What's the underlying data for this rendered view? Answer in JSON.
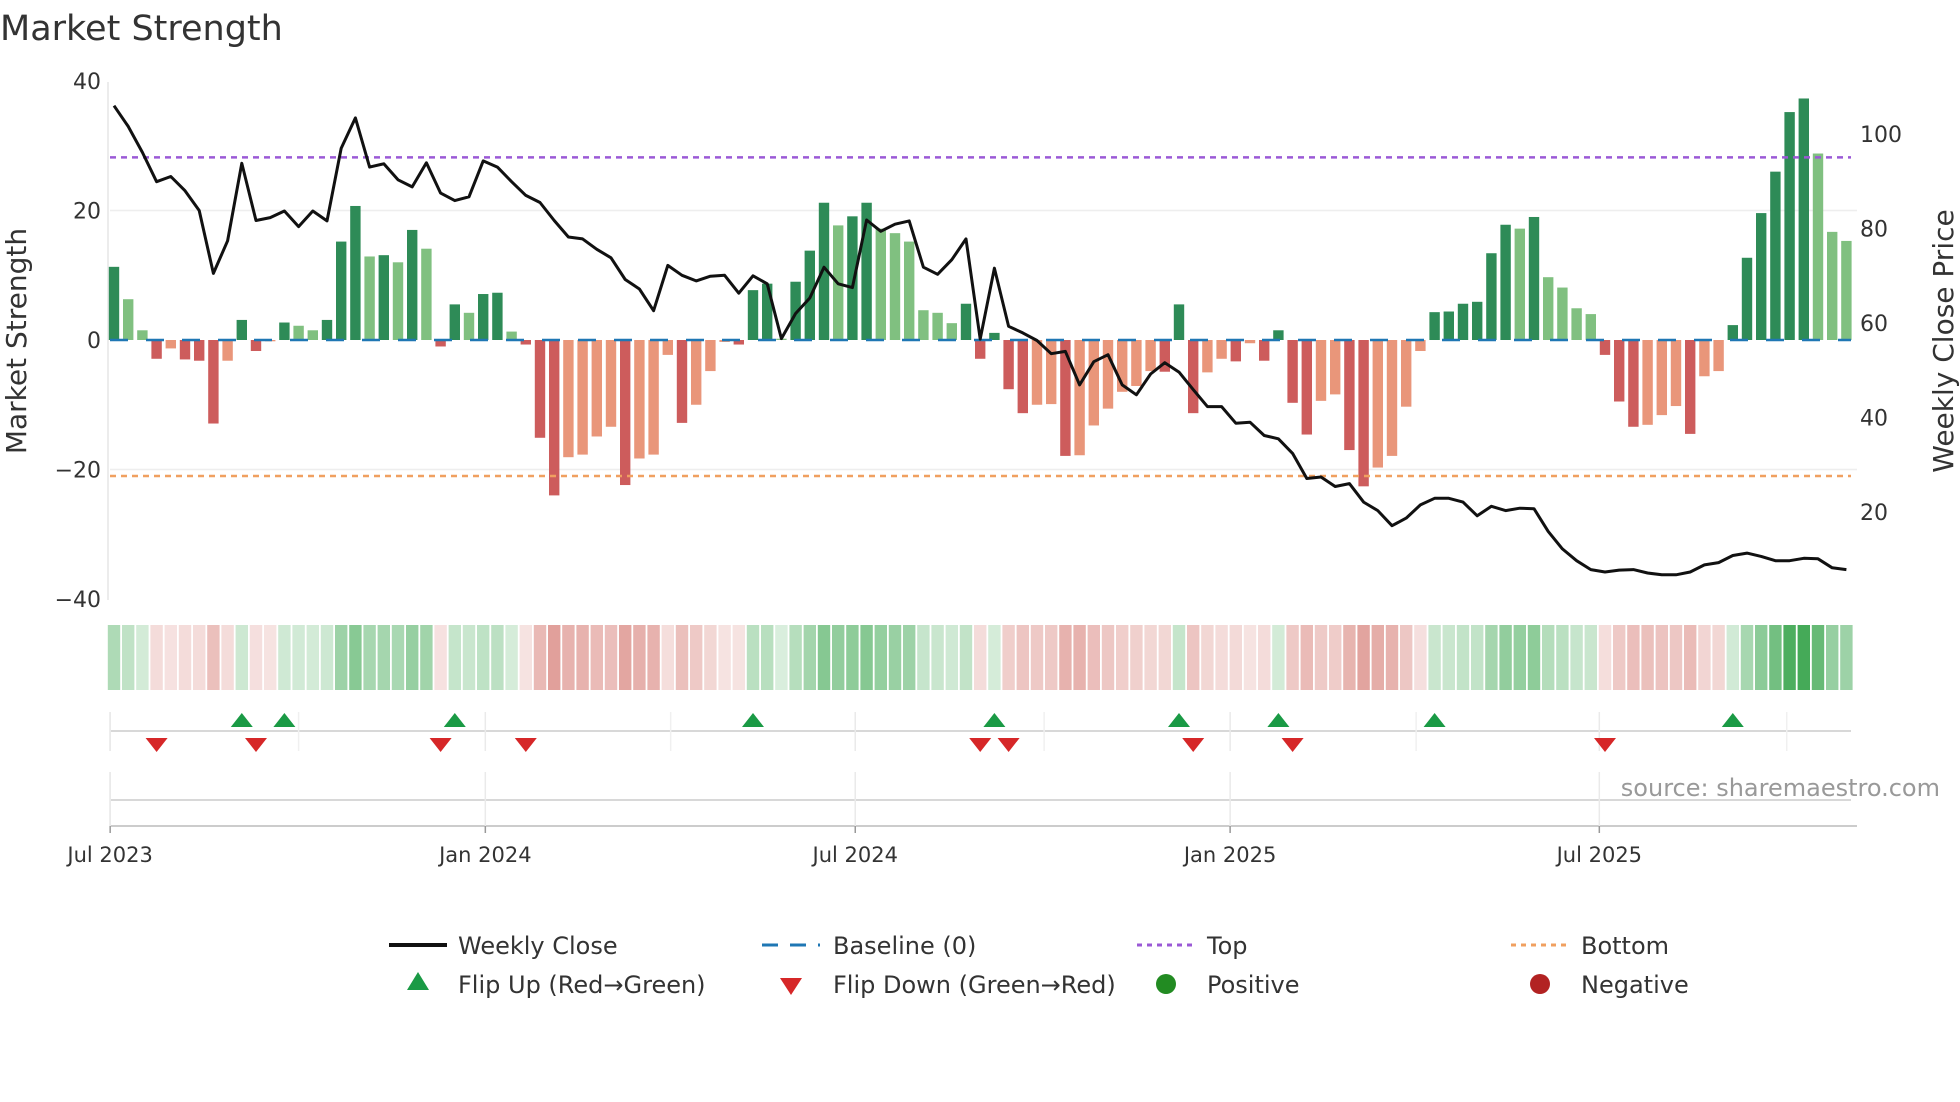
{
  "chart_data": {
    "type": "bar",
    "title": "Market Strength",
    "ylabel": "Market Strength",
    "y2label": "Weekly Close Price",
    "ylim": [
      -40,
      40
    ],
    "y2lim": [
      1.4,
      111
    ],
    "y_ticks": [
      "40",
      "20",
      "0",
      "−20",
      "−40"
    ],
    "y_tick_values": [
      40,
      20,
      0,
      -20,
      -40
    ],
    "y2_ticks": [
      "100",
      "80",
      "60",
      "40",
      "20"
    ],
    "y2_tick_values": [
      100,
      80,
      60,
      40,
      20
    ],
    "x_ticks": [
      {
        "label": "Jul 2023",
        "week": -0.27
      },
      {
        "label": "Jan 2024",
        "week": 26.15
      },
      {
        "label": "Jul 2024",
        "week": 52.2
      },
      {
        "label": "Jan 2025",
        "week": 78.6
      },
      {
        "label": "Jul 2025",
        "week": 104.6
      }
    ],
    "x_minor_weeks": [
      13.0,
      39.2,
      65.5,
      91.7,
      117.8
    ],
    "top_level": 28.2,
    "bottom_level": -21,
    "baseline": 0,
    "strength": [
      11.3,
      6.3,
      1.5,
      -2.9,
      -1.3,
      -3,
      -3.2,
      -12.9,
      -3.2,
      3.1,
      -1.7,
      -0.2,
      2.7,
      2.2,
      1.5,
      3.1,
      15.2,
      20.7,
      12.9,
      13.1,
      12,
      17,
      14.1,
      -1,
      5.5,
      4.2,
      7.1,
      7.3,
      1.3,
      -0.7,
      -15.1,
      -24,
      -18.1,
      -17.7,
      -14.9,
      -13.4,
      -22.4,
      -18.3,
      -17.7,
      -2.3,
      -12.8,
      -10,
      -4.8,
      -0.3,
      -0.7,
      7.7,
      8.7,
      0.2,
      9,
      13.8,
      21.2,
      17.7,
      19.1,
      21.2,
      17.2,
      16.5,
      15.2,
      4.6,
      4.2,
      2.6,
      5.6,
      -2.9,
      1.1,
      -7.6,
      -11.3,
      -10,
      -9.9,
      -17.9,
      -17.8,
      -13.2,
      -10.6,
      -8,
      -7.1,
      -4.8,
      -4.9,
      5.5,
      -11.3,
      -5,
      -2.9,
      -3.3,
      -0.5,
      -3.2,
      1.5,
      -9.7,
      -14.6,
      -9.4,
      -8.4,
      -17,
      -22.6,
      -19.7,
      -17.9,
      -10.3,
      -1.7,
      4.3,
      4.4,
      5.6,
      5.9,
      13.4,
      17.8,
      17.2,
      19,
      9.7,
      8.1,
      4.9,
      4,
      -2.3,
      -9.5,
      -13.4,
      -13.1,
      -11.6,
      -10.2,
      -14.5,
      -5.6,
      -4.8,
      2.3,
      12.7,
      19.6,
      26,
      35.2,
      37.3,
      28.8,
      16.7,
      15.3
    ],
    "weekly_close": [
      106,
      101.6,
      96.1,
      89.9,
      91,
      88,
      83.8,
      70.5,
      77.4,
      93.8,
      81.7,
      82.3,
      83.7,
      80.4,
      83.7,
      81.6,
      97,
      103.4,
      93,
      93.7,
      90.3,
      88.8,
      93.9,
      87.5,
      85.9,
      86.7,
      94.3,
      93,
      89.9,
      87,
      85.5,
      81.7,
      78.2,
      77.8,
      75.6,
      73.8,
      69.2,
      67.2,
      62.6,
      72.2,
      70.1,
      68.9,
      69.9,
      70.1,
      66.3,
      70,
      68.3,
      56.7,
      62,
      65.3,
      71.8,
      68.3,
      67.5,
      81.8,
      79.4,
      80.9,
      81.6,
      71.8,
      70.3,
      73.4,
      77.8,
      56.6,
      71.6,
      59.3,
      57.9,
      56.3,
      53.5,
      54,
      46.9,
      51.8,
      53.3,
      46.9,
      44.8,
      49.2,
      51.6,
      49.6,
      45.9,
      42.3,
      42.3,
      38.8,
      39,
      36.2,
      35.5,
      32.4,
      27.1,
      27.4,
      25.4,
      26,
      22.1,
      20.3,
      17.1,
      18.7,
      21.5,
      22.9,
      22.9,
      22.1,
      19.2,
      21.2,
      20.3,
      20.8,
      20.7,
      15.9,
      12.2,
      9.7,
      7.8,
      7.3,
      7.7,
      7.8,
      7.1,
      6.7,
      6.7,
      7.3,
      8.8,
      9.3,
      10.8,
      11.3,
      10.6,
      9.7,
      9.7,
      10.2,
      10.1,
      8.2,
      7.8
    ],
    "flip_up_weeks": [
      9,
      12,
      24,
      45,
      62,
      75,
      82,
      93,
      114
    ],
    "flip_down_weeks": [
      3,
      10,
      23,
      29,
      61,
      63,
      76,
      83,
      105
    ],
    "legend": {
      "weekly_close": "Weekly Close",
      "baseline": "Baseline (0)",
      "top": "Top",
      "bottom": "Bottom",
      "flip_up": "Flip Up (Red→Green)",
      "flip_down": "Flip Down (Green→Red)",
      "positive": "Positive",
      "negative": "Negative"
    },
    "legend_placement": "bottom",
    "source": "source: sharemaestro.com",
    "colors": {
      "pos_rising": "#2e8b57",
      "pos_falling": "#80c080",
      "neg_falling": "#cd5c5c",
      "neg_rising": "#e9967a",
      "line": "#111111",
      "baseline": "#1f77b4",
      "top": "#9b59d6",
      "bottom": "#f0a060",
      "flip_up": "#1a9a45",
      "flip_down": "#d62728",
      "positive": "#228b22",
      "negative": "#b22222"
    }
  }
}
